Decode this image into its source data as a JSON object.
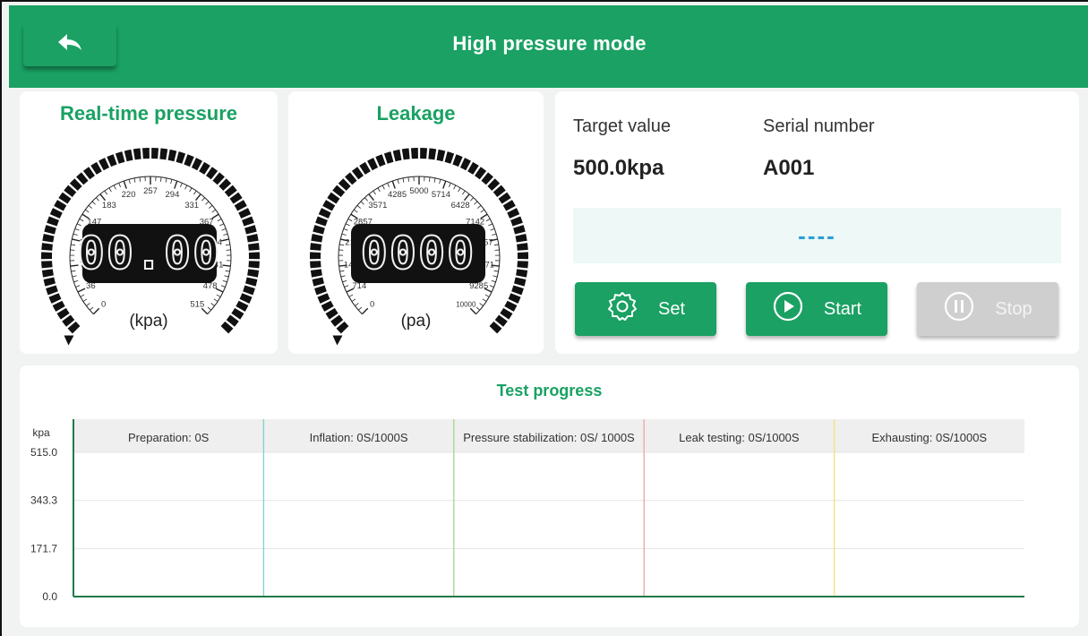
{
  "header": {
    "title": "High pressure mode",
    "back_icon": "back-arrow-icon"
  },
  "pressure_gauge": {
    "title": "Real-time pressure",
    "display": "00.00",
    "unit": "(kpa)",
    "ticks": [
      "0",
      "36",
      "73",
      "110",
      "147",
      "183",
      "220",
      "257",
      "294",
      "331",
      "367",
      "404",
      "441",
      "478",
      "515"
    ]
  },
  "leakage_gauge": {
    "title": "Leakage",
    "display": "0000",
    "unit": "(pa)",
    "ticks": [
      "0",
      "714",
      "1428",
      "2142",
      "2857",
      "3571",
      "4285",
      "5000",
      "5714",
      "6428",
      "7142",
      "7857",
      "8571",
      "9285",
      "10000"
    ]
  },
  "info": {
    "target_label": "Target value",
    "target_value": "500.0kpa",
    "serial_label": "Serial number",
    "serial_value": "A001",
    "status": "----"
  },
  "buttons": {
    "set": "Set",
    "start": "Start",
    "stop": "Stop"
  },
  "progress": {
    "title": "Test progress",
    "y_unit": "kpa",
    "y_ticks": [
      "515.0",
      "343.3",
      "171.7",
      "0.0"
    ],
    "stages": [
      {
        "label": "Preparation: 0S",
        "divider_color": "#7fd3c8"
      },
      {
        "label": "Inflation: 0S/1000S",
        "divider_color": "#a6d489"
      },
      {
        "label": "Pressure stabilization: 0S/ 1000S",
        "divider_color": "#f2a3a3"
      },
      {
        "label": "Leak testing: 0S/1000S",
        "divider_color": "#f2e27a"
      },
      {
        "label": "Exhausting: 0S/1000S",
        "divider_color": ""
      }
    ]
  },
  "colors": {
    "brand_green": "#1aa163",
    "status_blue": "#2a9fd8"
  }
}
